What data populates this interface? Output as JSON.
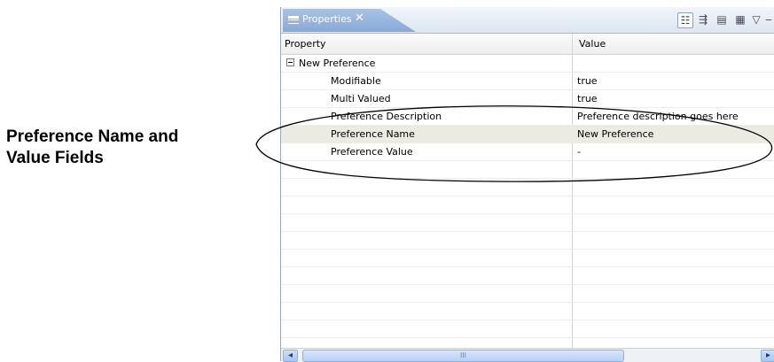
{
  "annotation": {
    "line1": "Preference Name and",
    "line2": "Value Fields"
  },
  "tab": {
    "label": "Properties",
    "close": "✕"
  },
  "toolbar": {
    "view_menu": "▽",
    "minimize": "▭",
    "maximize": "▭"
  },
  "table": {
    "headers": {
      "property": "Property",
      "value": "Value"
    },
    "rows": [
      {
        "name": "New Preference",
        "value": "",
        "expandable": true
      },
      {
        "name": "Modifiable",
        "value": "true"
      },
      {
        "name": "Multi Valued",
        "value": "true"
      },
      {
        "name": "Preference Description",
        "value": "Preference description goes here"
      },
      {
        "name": "Preference Name",
        "value": "New Preference",
        "selected": true
      },
      {
        "name": "Preference Value",
        "value": "-"
      }
    ]
  },
  "scrollbar": {
    "left": "◂",
    "right": "▸",
    "grip": "III"
  }
}
